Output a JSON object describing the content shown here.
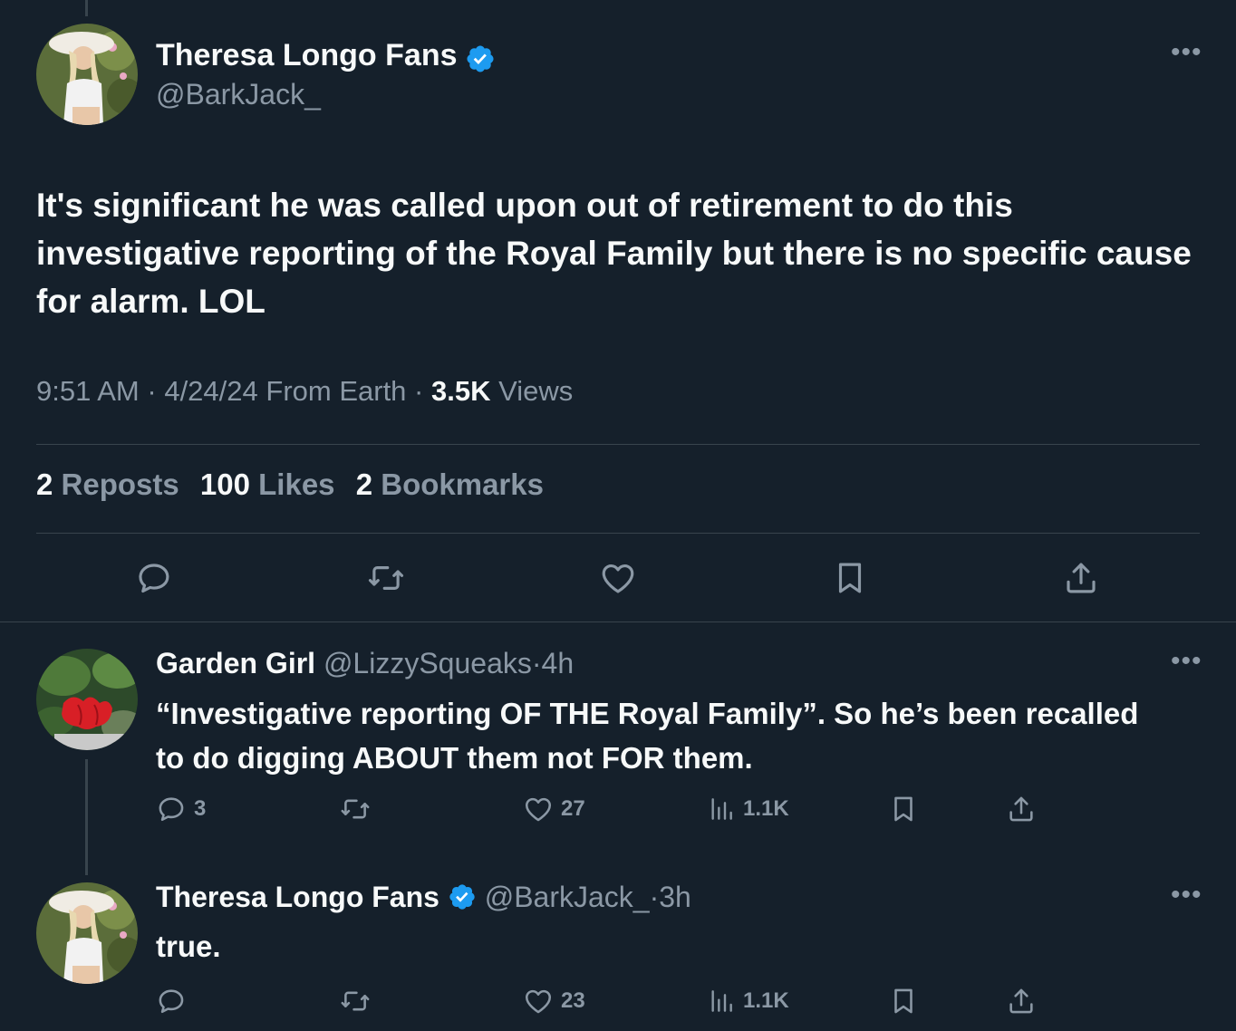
{
  "main_tweet": {
    "display_name": "Theresa Longo Fans",
    "handle": "@BarkJack_",
    "text": "It's significant he was called upon out of retirement to do this investigative reporting of the Royal Family but there is no specific cause for alarm. LOL",
    "time": "9:51 AM",
    "date": "4/24/24",
    "source": "From Earth",
    "views_count": "3.5K",
    "views_label": "Views",
    "reposts_count": "2",
    "reposts_label": "Reposts",
    "likes_count": "100",
    "likes_label": "Likes",
    "bookmarks_count": "2",
    "bookmarks_label": "Bookmarks",
    "sep": "·"
  },
  "replies": [
    {
      "display_name": "Garden Girl",
      "handle": "@LizzySqueaks",
      "age": "4h",
      "text": "“Investigative reporting OF THE Royal Family”. So he’s been recalled to do digging ABOUT them not FOR them.",
      "reply_count": "3",
      "like_count": "27",
      "view_count": "1.1K"
    },
    {
      "display_name": "Theresa Longo Fans",
      "handle": "@BarkJack_",
      "age": "3h",
      "text": "true.",
      "like_count": "23",
      "view_count": "1.1K"
    }
  ],
  "colors": {
    "background": "#15202b",
    "muted": "#8b98a5",
    "verified": "#1d9bf0",
    "divider": "#38444d"
  },
  "icons": [
    "verified-badge-icon",
    "more-icon",
    "reply-icon",
    "repost-icon",
    "like-icon",
    "bookmark-icon",
    "share-icon",
    "views-icon"
  ]
}
